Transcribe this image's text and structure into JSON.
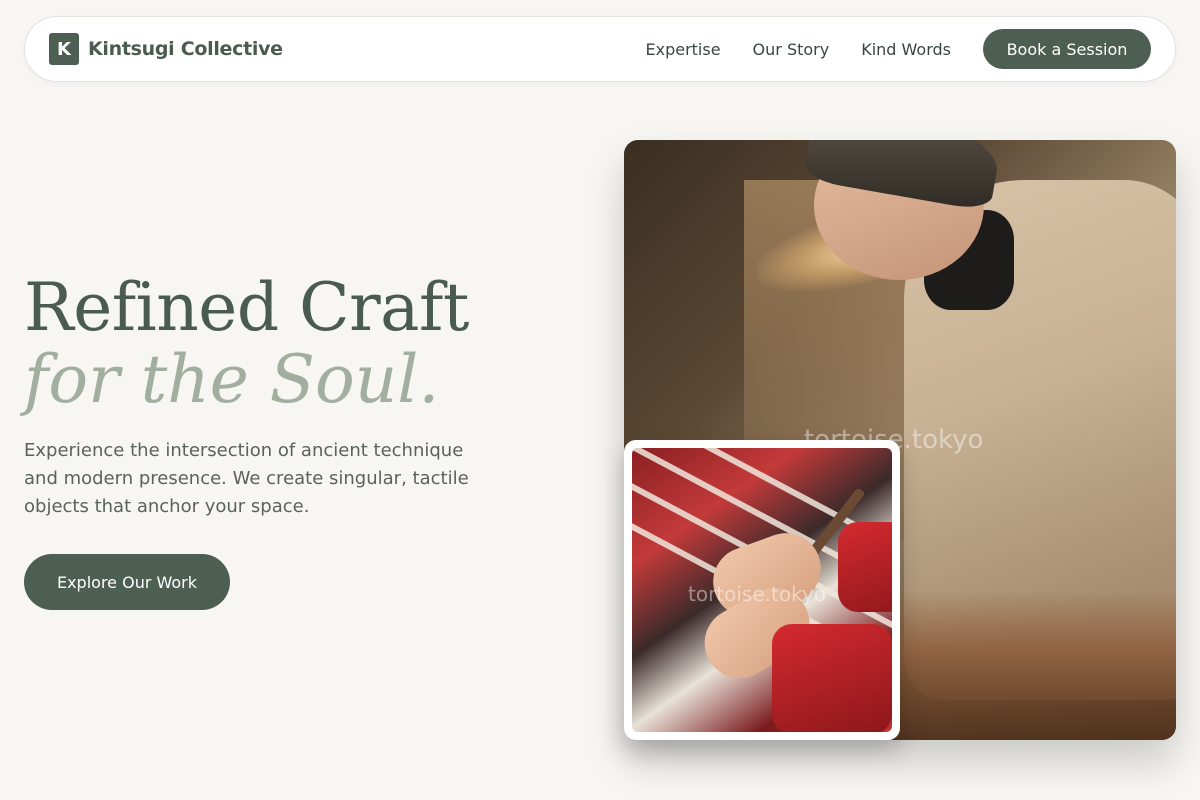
{
  "nav": {
    "brand_mark": "K",
    "brand_name": "Kintsugi Collective",
    "links": [
      "Expertise",
      "Our Story",
      "Kind Words"
    ],
    "cta": "Book a Session"
  },
  "hero": {
    "title_line1": "Refined Craft",
    "title_line2": "for the Soul.",
    "description": "Experience the intersection of ancient technique and modern presence. We create singular, tactile objects that anchor your space.",
    "cta": "Explore Our Work"
  },
  "images": {
    "main_watermark": "tortoise.tokyo",
    "inset_watermark": "tortoise.tokyo"
  },
  "colors": {
    "background": "#f7f6f2",
    "primary": "#4d5e52",
    "accent_muted": "#a2ae9f"
  }
}
